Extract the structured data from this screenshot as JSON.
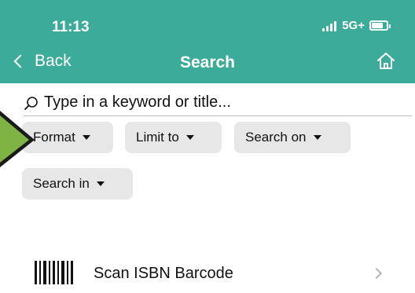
{
  "status_bar": {
    "time": "11:13",
    "network": "5G+",
    "battery_level": 0.8
  },
  "nav": {
    "back_label": "Back",
    "title": "Search"
  },
  "search": {
    "placeholder": "Type in a keyword or title..."
  },
  "filters": [
    {
      "label": "Format"
    },
    {
      "label": "Limit to"
    },
    {
      "label": "Search on"
    },
    {
      "label": "Search in"
    }
  ],
  "scan": {
    "label": "Scan ISBN Barcode"
  },
  "colors": {
    "header": "#3cab99",
    "chip": "#e7e7e7",
    "indicator": "#7cb342"
  }
}
